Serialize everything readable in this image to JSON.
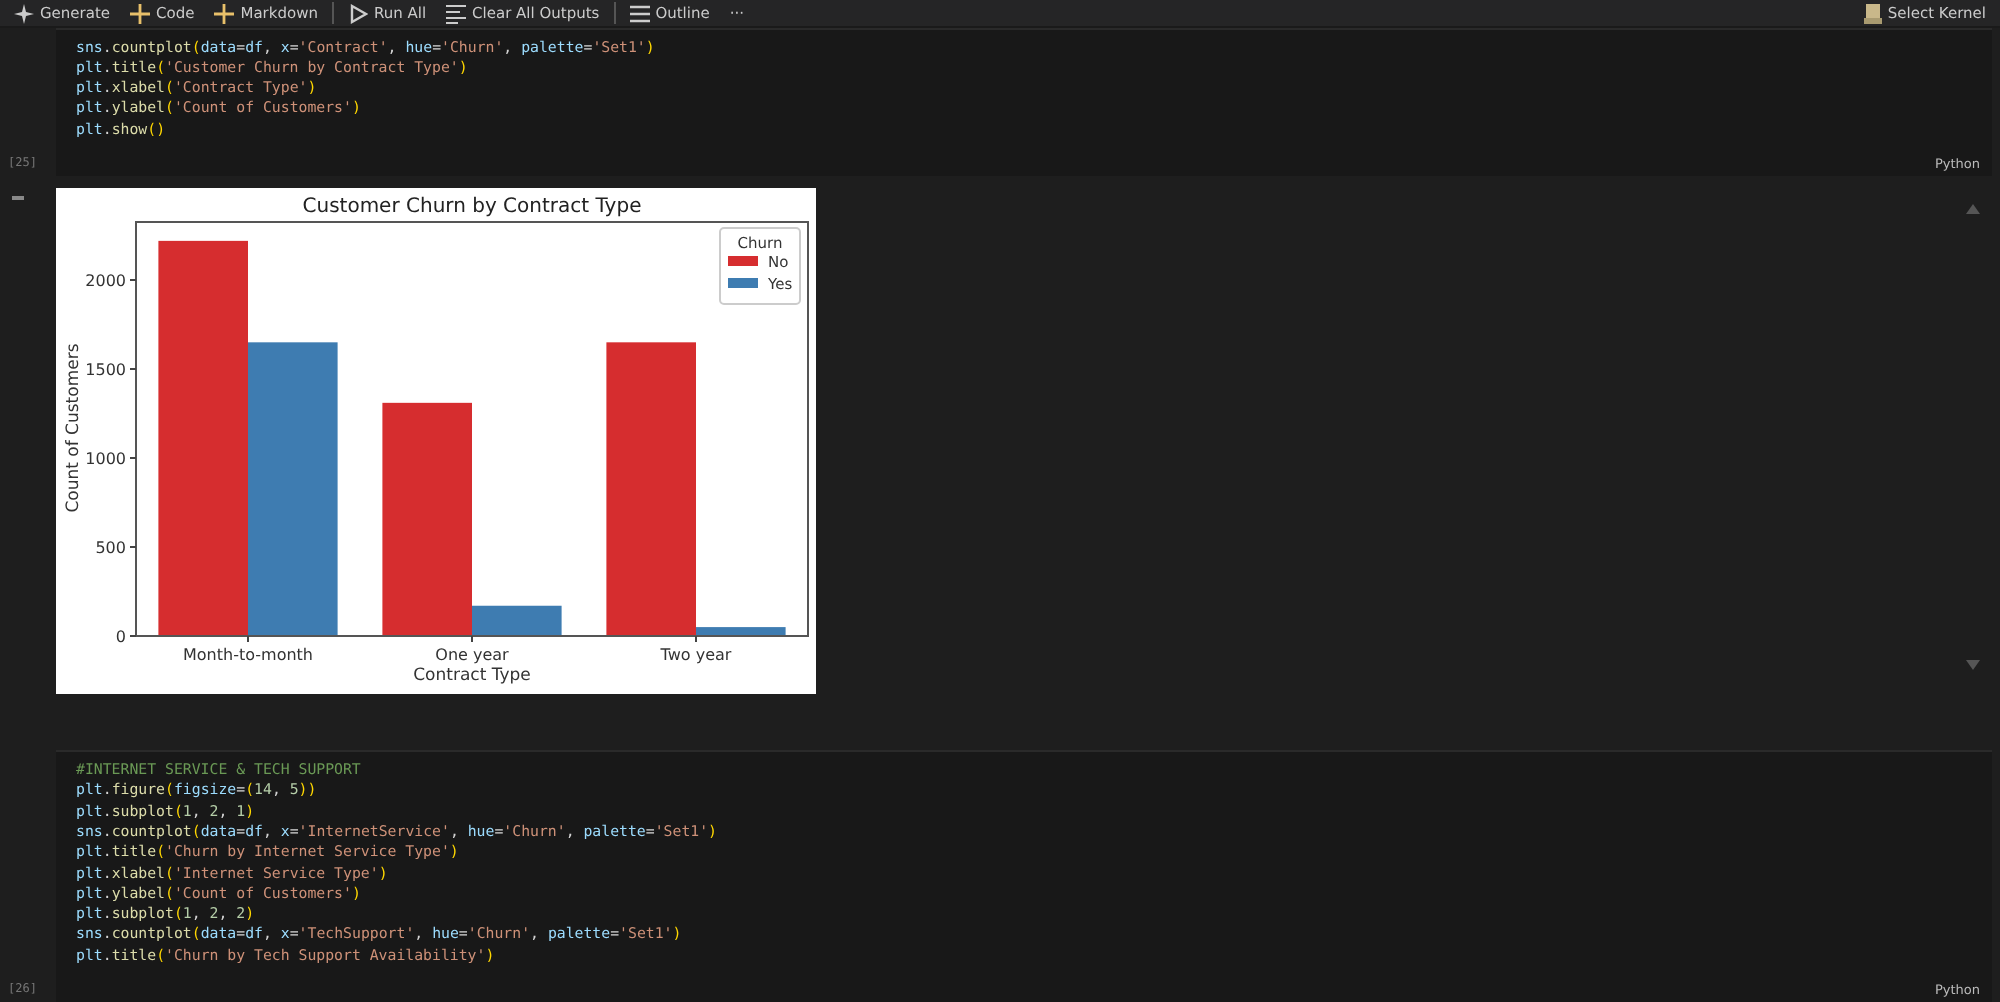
{
  "toolbar": {
    "items": [
      "Generate",
      "Code",
      "Markdown",
      "Run All",
      "Clear All Outputs",
      "Outline",
      "···"
    ],
    "kernel": "Select Kernel"
  },
  "cells": [
    {
      "count": "[25]",
      "language": "Python",
      "lines": [
        "sns.countplot(data=df, x='Contract', hue='Churn', palette='Set1')",
        "plt.title('Customer Churn by Contract Type')",
        "plt.xlabel('Contract Type')",
        "plt.ylabel('Count of Customers')",
        "plt.show()"
      ],
      "output": {
        "chart_data": {
          "type": "bar",
          "title": "Customer Churn by Contract Type",
          "xlabel": "Contract Type",
          "ylabel": "Count of Customers",
          "categories": [
            "Month-to-month",
            "One year",
            "Two year"
          ],
          "series": [
            {
              "name": "No",
              "color": "#d62d2f",
              "values": [
                2220,
                1310,
                1650
              ]
            },
            {
              "name": "Yes",
              "color": "#3e7cb1",
              "values": [
                1650,
                170,
                50
              ]
            }
          ],
          "ylim": [
            0,
            2326
          ],
          "yticks": [
            0,
            500,
            1000,
            1500,
            2000
          ],
          "legend": {
            "title": "Churn"
          }
        }
      }
    },
    {
      "count": "[26]",
      "language": "Python",
      "lines": [
        "#INTERNET SERVICE & TECH SUPPORT",
        "plt.figure(figsize=(14, 5))",
        "plt.subplot(1, 2, 1)",
        "sns.countplot(data=df, x='InternetService', hue='Churn', palette='Set1')",
        "plt.title('Churn by Internet Service Type')",
        "plt.xlabel('Internet Service Type')",
        "plt.ylabel('Count of Customers')",
        "plt.subplot(1, 2, 2)",
        "sns.countplot(data=df, x='TechSupport', hue='Churn', palette='Set1')",
        "plt.title('Churn by Tech Support Availability')"
      ]
    }
  ]
}
